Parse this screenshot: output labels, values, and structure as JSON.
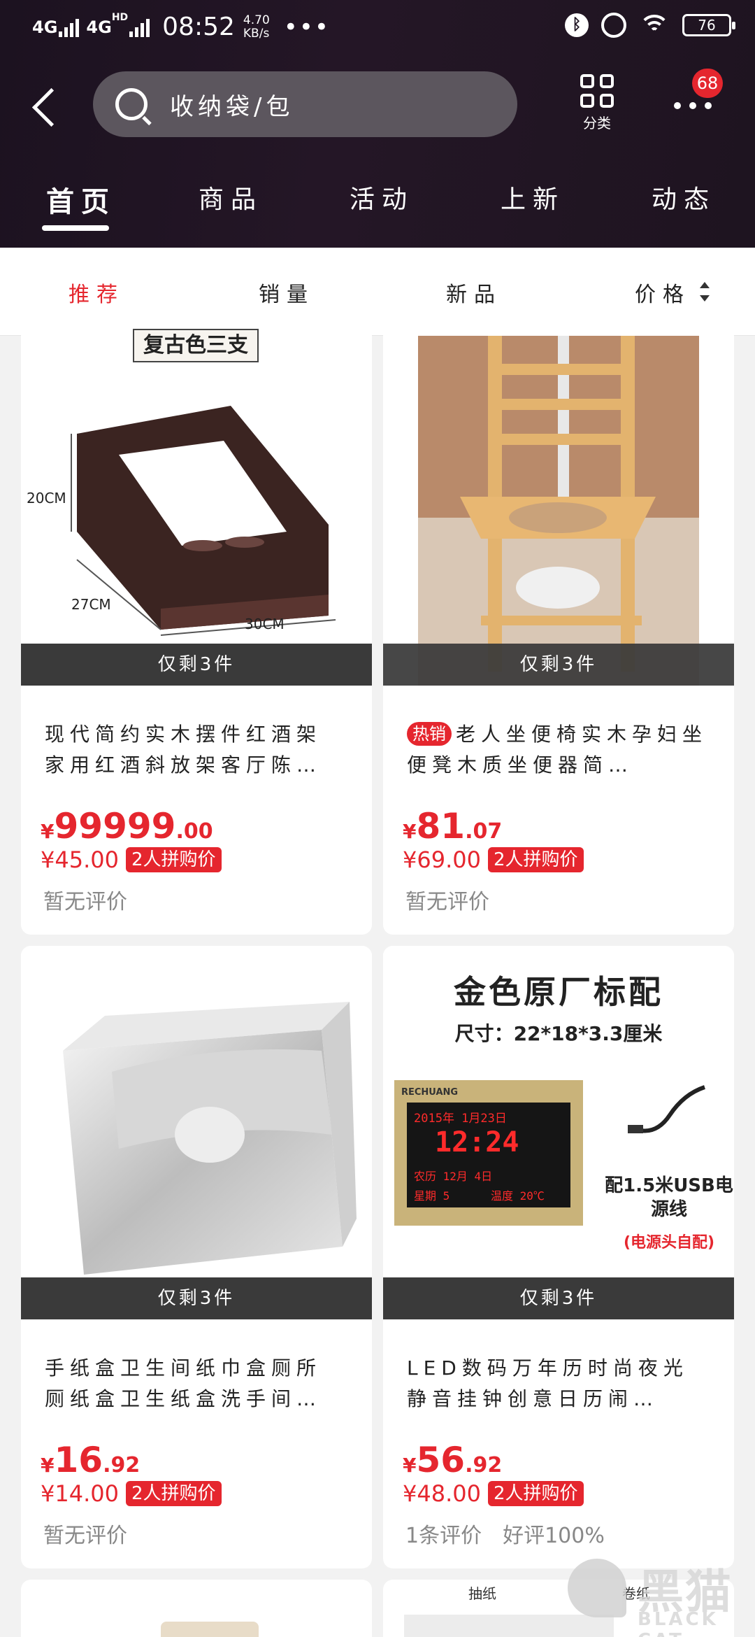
{
  "status_bar": {
    "network": "4G",
    "network2": "4G",
    "network2_sup": "HD",
    "time": "08:52",
    "speed": "4.70",
    "speed_unit": "KB/s",
    "battery": "76"
  },
  "search": {
    "text": "收纳袋/包"
  },
  "header": {
    "categories_label": "分类",
    "notification_count": "68"
  },
  "nav_tabs": [
    "首页",
    "商品",
    "活动",
    "上新",
    "动态"
  ],
  "sort_bar": [
    "推荐",
    "销量",
    "新品",
    "价格"
  ],
  "products": [
    {
      "image_caption": "复古色三支",
      "dims": [
        "20CM",
        "27CM",
        "30CM"
      ],
      "stock": "仅剩3件",
      "title": "现代简约实木摆件红酒架家用红酒斜放架客厅陈…",
      "price_int": "99999",
      "price_dec": ".00",
      "group_price": "¥45.00",
      "group_tag": "2人拼购价",
      "reviews": [
        "暂无评价"
      ]
    },
    {
      "stock": "仅剩3件",
      "hot_tag": "热销",
      "title": "老人坐便椅实木孕妇坐便凳木质坐便器简…",
      "price_int": "81",
      "price_dec": ".07",
      "group_price": "¥69.00",
      "group_tag": "2人拼购价",
      "reviews": [
        "暂无评价"
      ]
    },
    {
      "stock": "仅剩3件",
      "title": "手纸盒卫生间纸巾盒厕所厕纸盒卫生纸盒洗手间…",
      "price_int": "16",
      "price_dec": ".92",
      "group_price": "¥14.00",
      "group_tag": "2人拼购价",
      "reviews": [
        "暂无评价"
      ]
    },
    {
      "image_title": "金色原厂标配",
      "image_size": "尺寸：22*18*3.3厘米",
      "clock_brand": "RECHUANG",
      "clock_date": "2015年 1月23日",
      "clock_time": "12:24",
      "clock_lunar": "农历 12月 4日",
      "clock_week": "星期 5",
      "clock_temp": "温度 20℃",
      "cable_text": "配1.5米USB电源线",
      "cable_note": "(电源头自配)",
      "stock": "仅剩3件",
      "title": "LED数码万年历时尚夜光静音挂钟创意日历闹…",
      "price_int": "56",
      "price_dec": ".92",
      "group_price": "¥48.00",
      "group_tag": "2人拼购价",
      "reviews": [
        "1条评价",
        "好评100%"
      ]
    }
  ],
  "partial_labels": [
    "抽纸",
    "卷纸"
  ],
  "watermark": {
    "cn": "黑猫",
    "en": "BLACK CAT"
  },
  "currency": "¥"
}
